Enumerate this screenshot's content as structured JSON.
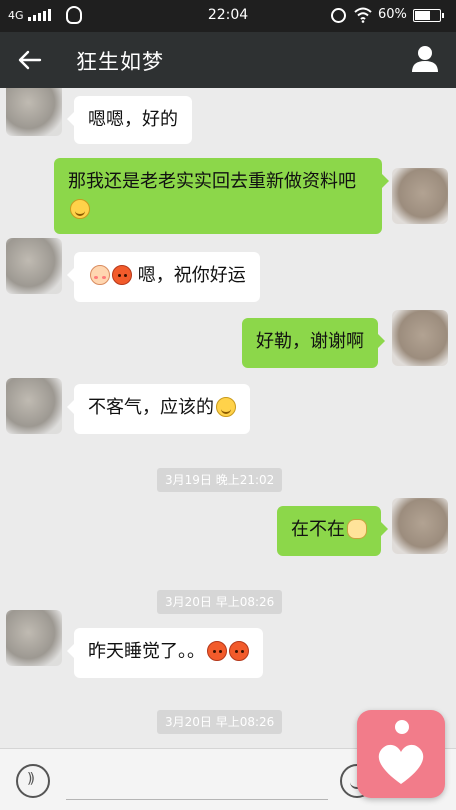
{
  "status_bar": {
    "network": "4G",
    "time": "22:04",
    "battery": "60%"
  },
  "header": {
    "title": "狂生如梦"
  },
  "messages": [
    {
      "side": "left",
      "text": "嗯嗯，好的"
    },
    {
      "side": "right",
      "text": "那我还是老老实实回去重新做资料吧",
      "emoji": [
        "smile"
      ]
    },
    {
      "side": "left",
      "text": "嗯，祝你好运",
      "emoji_before": [
        "blush",
        "angry"
      ]
    },
    {
      "side": "right",
      "text": "好勒，谢谢啊"
    },
    {
      "side": "left",
      "text": "不客气，应该的",
      "emoji": [
        "smile"
      ]
    },
    {
      "side": "time",
      "text": "3月19日 晚上21:02"
    },
    {
      "side": "right",
      "text": "在不在",
      "emoji": [
        "pig"
      ]
    },
    {
      "side": "time",
      "text": "3月20日 早上08:26"
    },
    {
      "side": "left",
      "text": "昨天睡觉了。。",
      "emoji": [
        "angry",
        "angry"
      ]
    },
    {
      "side": "time",
      "text": "3月20日 早上08:26"
    }
  ],
  "colors": {
    "header_bg": "#2e3132",
    "right_bubble": "#8cd74a",
    "left_bubble": "#ffffff",
    "chat_bg": "#ebebeb",
    "floater": "#f27c8a"
  },
  "icons": {
    "back": "arrow-left-icon",
    "profile": "person-icon",
    "voice": "voice-icon",
    "emoji": "emoji-icon",
    "floater": "heart-app-icon"
  }
}
